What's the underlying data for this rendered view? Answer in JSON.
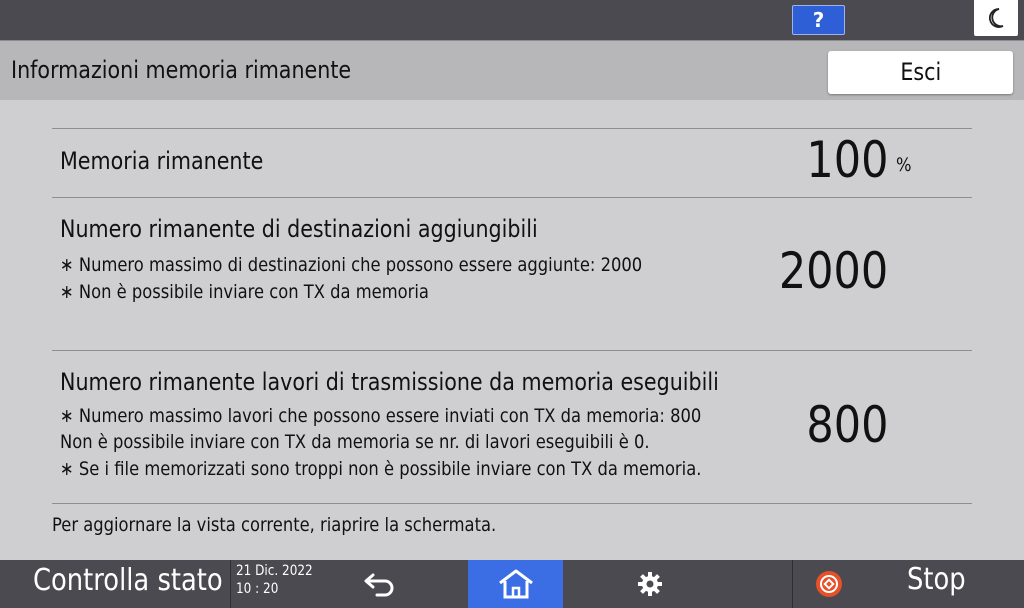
{
  "topbar": {
    "help_label": "?",
    "help_icon": "question-icon",
    "night_icon": "moon-icon"
  },
  "header": {
    "title": "Informazioni memoria rimanente",
    "exit_label": "Esci"
  },
  "sections": [
    {
      "label": "Memoria rimanente",
      "notes": [],
      "value": "100",
      "unit": "%"
    },
    {
      "label": "Numero rimanente di destinazioni aggiungibili",
      "notes": [
        "∗ Numero massimo di destinazioni che possono essere aggiunte: 2000",
        "∗ Non è possibile inviare con TX da memoria"
      ],
      "value": "2000",
      "unit": ""
    },
    {
      "label": "Numero rimanente lavori di trasmissione da memoria eseguibili",
      "notes": [
        "∗ Numero massimo lavori che possono essere inviati con TX da memoria: 800",
        "Non è possibile inviare con TX da memoria se nr. di lavori eseguibili è 0.",
        "∗ Se i file memorizzati sono troppi non è possibile inviare con TX da memoria."
      ],
      "value": "800",
      "unit": ""
    }
  ],
  "footer_note": "Per aggiornare la vista corrente, riaprire la schermata.",
  "bottombar": {
    "status_label": "Controlla stato",
    "date": "21 Dic. 2022",
    "time": "10 : 20",
    "back_icon": "back-arrow-icon",
    "home_icon": "home-icon",
    "settings_icon": "gear-icon",
    "stop_label": "Stop",
    "stop_icon": "stop-icon"
  },
  "colors": {
    "accent_blue": "#3b6ee5",
    "help_blue": "#2f5fd6",
    "stop_orange": "#e8502a",
    "bar_dark": "#4a4a50",
    "content_bg": "#cfcfd1",
    "header_bg": "#b7b7b9"
  }
}
